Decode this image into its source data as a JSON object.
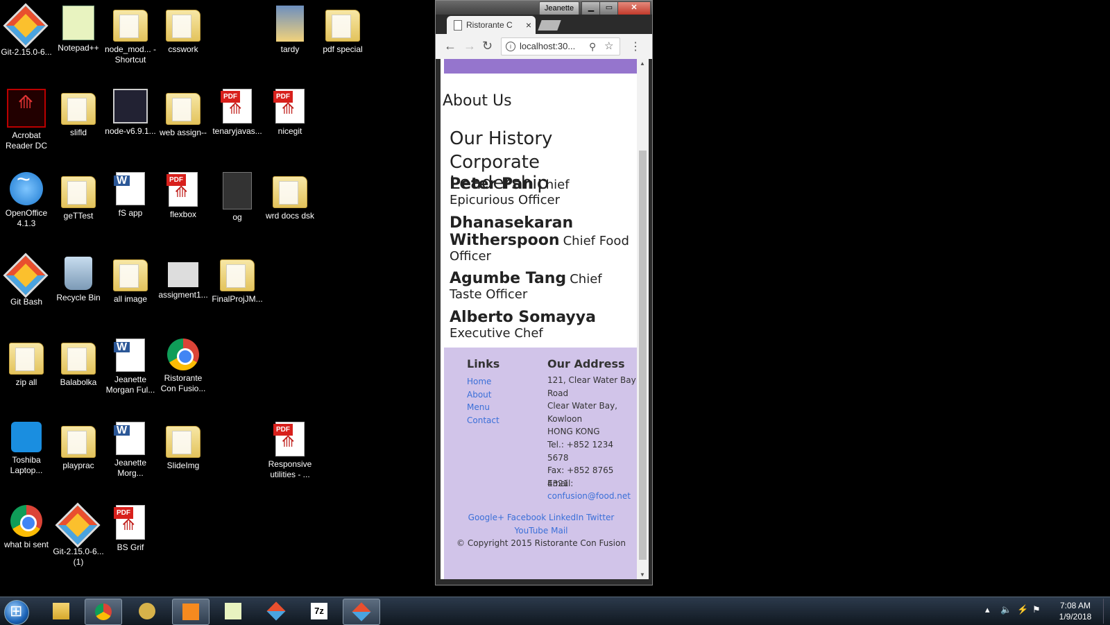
{
  "desktop": {
    "icons": [
      {
        "label": "Git-2.15.0-6...",
        "icon": "git-icon"
      },
      {
        "label": "Notepad++",
        "icon": "notepad-plus-icon"
      },
      {
        "label": "node_mod... - Shortcut",
        "icon": "folder-icon"
      },
      {
        "label": "csswork",
        "icon": "folder-icon"
      },
      {
        "label": "tardy",
        "icon": "photo-icon"
      },
      {
        "label": "pdf special",
        "icon": "folder-icon"
      },
      {
        "label": "Acrobat Reader DC",
        "icon": "acrobat-icon"
      },
      {
        "label": "slifld",
        "icon": "folder-icon"
      },
      {
        "label": "node-v6.9.1...",
        "icon": "installer-icon"
      },
      {
        "label": "web assign--",
        "icon": "folder-icon"
      },
      {
        "label": "tenaryjavas...",
        "icon": "pdf-icon"
      },
      {
        "label": "nicegit",
        "icon": "pdf-icon"
      },
      {
        "label": "OpenOffice 4.1.3",
        "icon": "openoffice-icon"
      },
      {
        "label": "geTTest",
        "icon": "folder-icon"
      },
      {
        "label": "fS app",
        "icon": "word-doc-icon"
      },
      {
        "label": "flexbox",
        "icon": "pdf-icon"
      },
      {
        "label": "og",
        "icon": "photo-icon"
      },
      {
        "label": "wrd docs dsk",
        "icon": "folder-icon"
      },
      {
        "label": "Git Bash",
        "icon": "git-icon"
      },
      {
        "label": "Recycle Bin",
        "icon": "recycle-bin-icon"
      },
      {
        "label": "all image",
        "icon": "folder-icon"
      },
      {
        "label": "assigment1...",
        "icon": "image-file-icon"
      },
      {
        "label": "FinalProjJM...",
        "icon": "folder-icon"
      },
      {
        "label": "zip all",
        "icon": "folder-icon"
      },
      {
        "label": "Balabolka",
        "icon": "folder-icon"
      },
      {
        "label": "Jeanette Morgan Ful...",
        "icon": "word-doc-icon"
      },
      {
        "label": "Ristorante Con Fusio...",
        "icon": "chrome-icon"
      },
      {
        "label": "Toshiba Laptop...",
        "icon": "toshiba-icon"
      },
      {
        "label": "playprac",
        "icon": "folder-icon"
      },
      {
        "label": "Jeanette Morg...",
        "icon": "word-doc-icon"
      },
      {
        "label": "SlideImg",
        "icon": "folder-icon"
      },
      {
        "label": "Responsive utilities - ...",
        "icon": "pdf-icon"
      },
      {
        "label": "what bi sent",
        "icon": "chrome-icon"
      },
      {
        "label": "Git-2.15.0-6... (1)",
        "icon": "git-icon"
      },
      {
        "label": "BS Grif",
        "icon": "pdf-icon"
      }
    ]
  },
  "browser": {
    "profile_name": "Jeanette",
    "tab_title": "Ristorante C",
    "tab_close": "×",
    "url": "localhost:30...",
    "page": {
      "about_heading": "About Us",
      "history_heading": "Our History",
      "leadership_heading": "Corporate Leadership",
      "leaders": [
        {
          "name": "Peter Pan",
          "role": "Chief Epicurious Officer"
        },
        {
          "name": "Dhanasekaran Witherspoon",
          "role": "Chief Food Officer"
        },
        {
          "name": "Agumbe Tang",
          "role": "Chief Taste Officer"
        },
        {
          "name": "Alberto Somayya",
          "role": "Executive Chef"
        }
      ],
      "footer": {
        "links_heading": "Links",
        "links": [
          "Home",
          "About",
          "Menu",
          "Contact"
        ],
        "address_heading": "Our Address",
        "address_lines": [
          "121, Clear Water Bay Road",
          "Clear Water Bay, Kowloon",
          "HONG KONG",
          "Tel.: +852 1234 5678",
          "Fax: +852 8765 4321",
          "Email:"
        ],
        "email": "confusion@food.net",
        "social": "Google+ Facebook LinkedIn Twitter YouTube Mail",
        "copyright": "© Copyright 2015 Ristorante Con Fusion"
      }
    }
  },
  "taskbar": {
    "apps": [
      {
        "name": "explorer"
      },
      {
        "name": "chrome",
        "active": true
      },
      {
        "name": "balabolka"
      },
      {
        "name": "sublime"
      },
      {
        "name": "notepad-plus"
      },
      {
        "name": "git"
      },
      {
        "name": "7zip",
        "label": "7z"
      },
      {
        "name": "git-bash",
        "active": true
      }
    ],
    "clock_time": "7:08 AM",
    "clock_date": "1/9/2018"
  }
}
